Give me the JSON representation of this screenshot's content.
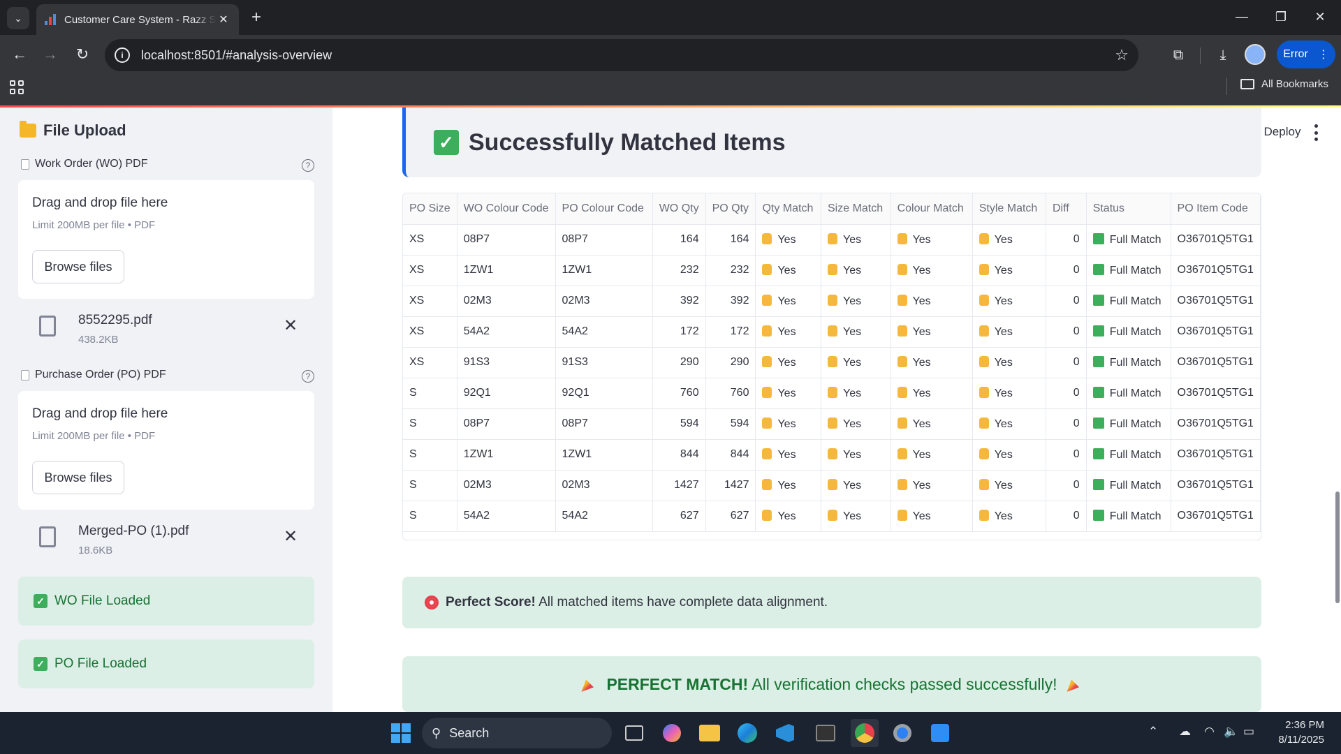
{
  "browser": {
    "tab_title": "Customer Care System - Razz Solutions",
    "tab_close": "✕",
    "new_tab": "+",
    "url": "localhost:8501/#analysis-overview",
    "error_label": "Error",
    "all_bookmarks": "All Bookmarks"
  },
  "sidebar": {
    "title": "File Upload",
    "wo_label": "Work Order (WO) PDF",
    "po_label": "Purchase Order (PO) PDF",
    "drop_text": "Drag and drop file here",
    "limit_text": "Limit 200MB per file • PDF",
    "browse_label": "Browse files",
    "wo_file": {
      "name": "8552295.pdf",
      "size": "438.2KB"
    },
    "po_file": {
      "name": "Merged-PO (1).pdf",
      "size": "18.6KB"
    },
    "wo_loaded": "WO File Loaded",
    "po_loaded": "PO File Loaded",
    "help": "?"
  },
  "main": {
    "heading": "Successfully Matched Items",
    "deploy": "Deploy",
    "table": {
      "columns": [
        "PO Size",
        "WO Colour Code",
        "PO Colour Code",
        "WO Qty",
        "PO Qty",
        "Qty Match",
        "Size Match",
        "Colour Match",
        "Style Match",
        "Diff",
        "Status",
        "PO Item Code"
      ],
      "rows": [
        [
          "XS",
          "08P7",
          "08P7",
          "164",
          "164",
          "Yes",
          "Yes",
          "Yes",
          "Yes",
          "0",
          "Full Match",
          "O36701Q5TG1"
        ],
        [
          "XS",
          "1ZW1",
          "1ZW1",
          "232",
          "232",
          "Yes",
          "Yes",
          "Yes",
          "Yes",
          "0",
          "Full Match",
          "O36701Q5TG1"
        ],
        [
          "XS",
          "02M3",
          "02M3",
          "392",
          "392",
          "Yes",
          "Yes",
          "Yes",
          "Yes",
          "0",
          "Full Match",
          "O36701Q5TG1"
        ],
        [
          "XS",
          "54A2",
          "54A2",
          "172",
          "172",
          "Yes",
          "Yes",
          "Yes",
          "Yes",
          "0",
          "Full Match",
          "O36701Q5TG1"
        ],
        [
          "XS",
          "91S3",
          "91S3",
          "290",
          "290",
          "Yes",
          "Yes",
          "Yes",
          "Yes",
          "0",
          "Full Match",
          "O36701Q5TG1"
        ],
        [
          "S",
          "92Q1",
          "92Q1",
          "760",
          "760",
          "Yes",
          "Yes",
          "Yes",
          "Yes",
          "0",
          "Full Match",
          "O36701Q5TG1"
        ],
        [
          "S",
          "08P7",
          "08P7",
          "594",
          "594",
          "Yes",
          "Yes",
          "Yes",
          "Yes",
          "0",
          "Full Match",
          "O36701Q5TG1"
        ],
        [
          "S",
          "1ZW1",
          "1ZW1",
          "844",
          "844",
          "Yes",
          "Yes",
          "Yes",
          "Yes",
          "0",
          "Full Match",
          "O36701Q5TG1"
        ],
        [
          "S",
          "02M3",
          "02M3",
          "1427",
          "1427",
          "Yes",
          "Yes",
          "Yes",
          "Yes",
          "0",
          "Full Match",
          "O36701Q5TG1"
        ],
        [
          "S",
          "54A2",
          "54A2",
          "627",
          "627",
          "Yes",
          "Yes",
          "Yes",
          "Yes",
          "0",
          "Full Match",
          "O36701Q5TG1"
        ]
      ]
    },
    "info_bold": "Perfect Score!",
    "info_text": "All matched items have complete data alignment.",
    "perfect_bold": "PERFECT MATCH!",
    "perfect_text": "All verification checks passed successfully!"
  },
  "taskbar": {
    "search": "Search",
    "time": "2:36 PM",
    "date": "8/11/2025"
  },
  "colors": {
    "accent": "#1c64f2",
    "success_bg": "#dcefe6",
    "success_text": "#177233"
  }
}
